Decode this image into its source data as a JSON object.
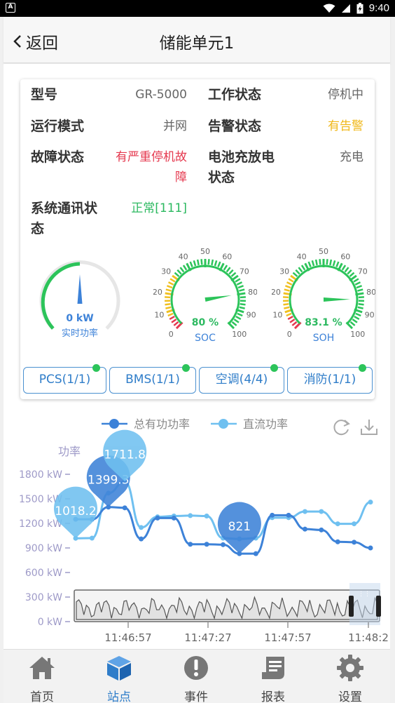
{
  "status_bar": {
    "time": "9:40",
    "app_icon_letter": "A"
  },
  "header": {
    "back_label": "返回",
    "title": "储能单元1"
  },
  "info": {
    "model_label": "型号",
    "model_value": "GR-5000",
    "work_status_label": "工作状态",
    "work_status_value": "停机中",
    "run_mode_label": "运行模式",
    "run_mode_value": "并网",
    "alarm_status_label": "告警状态",
    "alarm_status_value": "有告警",
    "fault_status_label": "故障状态",
    "fault_status_value": "有严重停机故障",
    "battery_label": "电池充放电状态",
    "battery_value": "充电",
    "comm_label": "系统通讯状态",
    "comm_value": "正常[111]",
    "colors": {
      "alarm": "#f0b81a",
      "fault": "#e5394f",
      "normal": "#2cb960"
    }
  },
  "gauges": {
    "power": {
      "value_text": "0 kW",
      "label": "实时功率",
      "value": 0
    },
    "soc": {
      "value_text": "80 %",
      "label": "SOC",
      "value": 80,
      "ticks": [
        "0",
        "10",
        "20",
        "30",
        "40",
        "50",
        "60",
        "70",
        "80",
        "90",
        "100"
      ]
    },
    "soh": {
      "value_text": "83.1 %",
      "label": "SOH",
      "value": 83.1,
      "ticks": [
        "0",
        "10",
        "20",
        "30",
        "40",
        "50",
        "60",
        "70",
        "80",
        "90",
        "100"
      ]
    }
  },
  "device_buttons": [
    {
      "label": "PCS(1/1)"
    },
    {
      "label": "BMS(1/1)"
    },
    {
      "label": "空调(4/4)"
    },
    {
      "label": "消防(1/1)"
    }
  ],
  "chart_data": {
    "type": "line",
    "legend": [
      "总有功功率",
      "直流功率"
    ],
    "ylabel": "功率",
    "y_ticks": [
      "0 kW",
      "300 kW",
      "600 kW",
      "900 kW",
      "1200 kW",
      "1500 kW",
      "1800 kW"
    ],
    "x_ticks": [
      "11:46:57",
      "11:47:27",
      "11:47:57",
      "11:48:2"
    ],
    "ylim": [
      0,
      1800
    ],
    "series": [
      {
        "name": "总有功功率",
        "color": "#3d82d8",
        "values": [
          1250,
          1250,
          1399.3,
          1390,
          1010,
          1265,
          1265,
          945,
          945,
          940,
          830,
          830,
          1300,
          1300,
          1130,
          1120,
          975,
          970,
          900
        ]
      },
      {
        "name": "直流功率",
        "color": "#6fc0f0",
        "values": [
          1018.2,
          1020,
          1570,
          1711.8,
          1150,
          1280,
          1290,
          1295,
          1290,
          1020,
          1010,
          1020,
          1270,
          1270,
          1345,
          1345,
          1195,
          1195,
          1460
        ]
      }
    ],
    "markers": [
      {
        "series": 1,
        "index": 0,
        "label": "1018.2"
      },
      {
        "series": 0,
        "index": 2,
        "label": "1399.3"
      },
      {
        "series": 1,
        "index": 3,
        "label": "1711.8"
      },
      {
        "series": 0,
        "index": 10,
        "label": "821"
      }
    ]
  },
  "tabs": [
    {
      "label": "首页",
      "icon": "home-icon"
    },
    {
      "label": "站点",
      "icon": "cube-icon"
    },
    {
      "label": "事件",
      "icon": "alert-icon"
    },
    {
      "label": "报表",
      "icon": "report-icon"
    },
    {
      "label": "设置",
      "icon": "gear-icon"
    }
  ]
}
